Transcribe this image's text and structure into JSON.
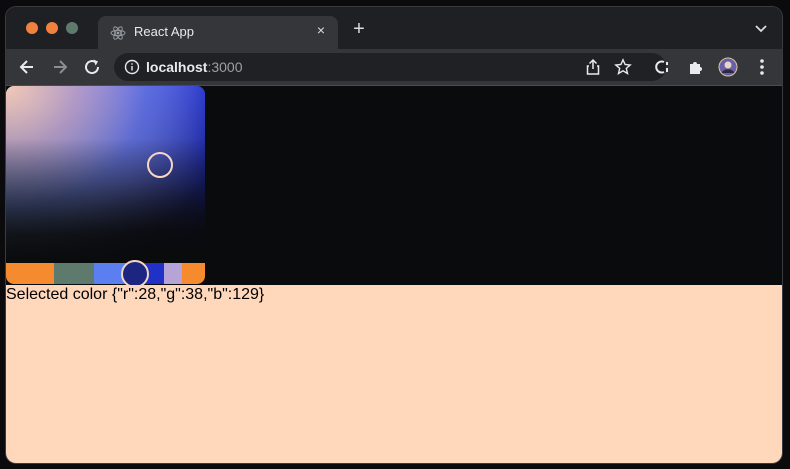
{
  "browser": {
    "tab_title": "React App",
    "tab_close_label": "×",
    "new_tab_label": "+",
    "url_host": "localhost",
    "url_port": ":3000"
  },
  "colors": {
    "tl_red": "#f0813e",
    "tl_yellow": "#f0813e",
    "tl_green": "#5e7a6d",
    "panel_bg": "#ffd8bc",
    "selected_rgb": "#1c2681"
  },
  "picker": {
    "swatches": [
      "#f58a2e",
      "#5e7a6d",
      "#5b7ff1",
      "#2130c7",
      "#b6a4d9",
      "#f58a2e"
    ]
  },
  "selected_color": {
    "label": "Selected color",
    "value_text": "{\"r\":28,\"g\":38,\"b\":129}"
  }
}
